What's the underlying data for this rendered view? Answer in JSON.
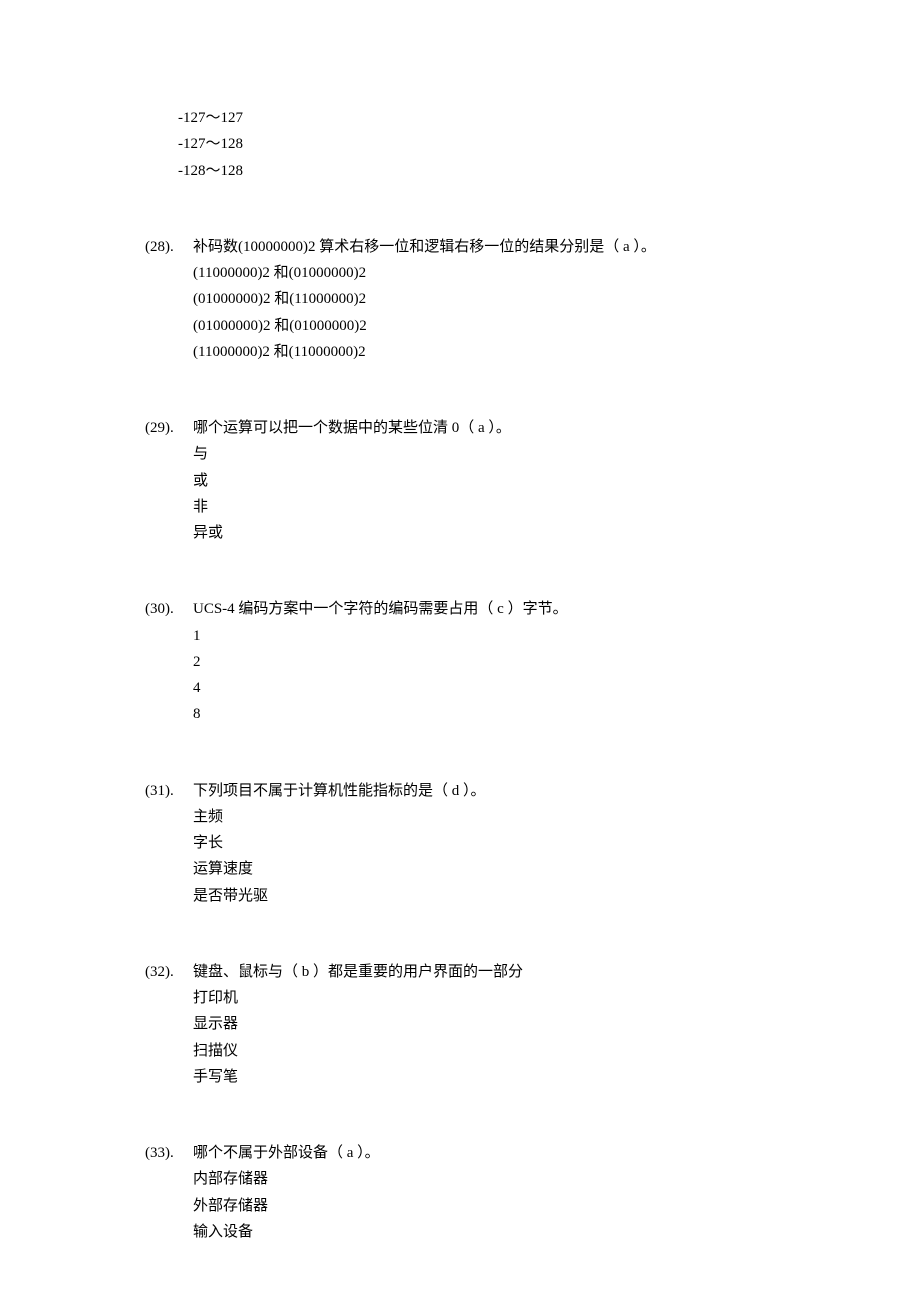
{
  "orphan_options": [
    "-127～127",
    "-127～128",
    "-128～128"
  ],
  "questions": [
    {
      "number": "(28).",
      "text": "补码数(10000000)2 算术右移一位和逻辑右移一位的结果分别是（  a  ）。",
      "options": [
        "(11000000)2 和(01000000)2",
        "(01000000)2 和(11000000)2",
        "(01000000)2 和(01000000)2",
        "(11000000)2 和(11000000)2"
      ]
    },
    {
      "number": "(29).",
      "text": "哪个运算可以把一个数据中的某些位清 0（  a  ）。",
      "options": [
        "与",
        "或",
        "非",
        "异或"
      ]
    },
    {
      "number": "(30).",
      "text": "UCS-4 编码方案中一个字符的编码需要占用（  c  ）字节。",
      "options": [
        "1",
        "2",
        "4",
        "8"
      ]
    },
    {
      "number": "(31).",
      "text": "下列项目不属于计算机性能指标的是（  d  ）。",
      "options": [
        "主频",
        "字长",
        "运算速度",
        "是否带光驱"
      ]
    },
    {
      "number": "(32).",
      "text": "键盘、鼠标与（  b  ）都是重要的用户界面的一部分",
      "options": [
        "打印机",
        "显示器",
        "扫描仪",
        "手写笔"
      ]
    },
    {
      "number": "(33).",
      "text": "哪个不属于外部设备（  a  ）。",
      "options": [
        "内部存储器",
        "外部存储器",
        "输入设备"
      ]
    }
  ]
}
